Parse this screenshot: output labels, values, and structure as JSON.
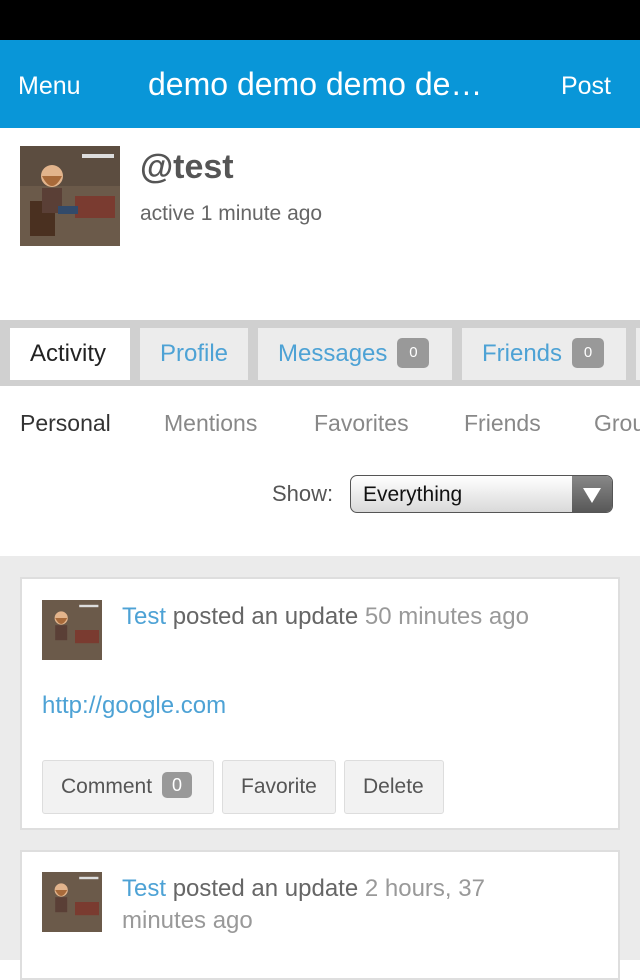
{
  "nav": {
    "menu_label": "Menu",
    "title": "demo demo demo demo",
    "post_label": "Post",
    "color": "#0996d8"
  },
  "profile": {
    "username": "@test",
    "active_text": "active 1 minute ago",
    "avatar_icon": "user-avatar"
  },
  "tabs": [
    {
      "label": "Activity",
      "count": null
    },
    {
      "label": "Profile",
      "count": null
    },
    {
      "label": "Messages",
      "count": "0"
    },
    {
      "label": "Friends",
      "count": "0"
    }
  ],
  "subnav": [
    "Personal",
    "Mentions",
    "Favorites",
    "Friends",
    "Groups"
  ],
  "filter": {
    "label": "Show:",
    "value": "Everything"
  },
  "activities": [
    {
      "user": "Test",
      "action": "posted an update",
      "time": "50 minutes ago",
      "content_link": "http://google.com",
      "buttons": {
        "comment": "Comment",
        "comment_count": "0",
        "favorite": "Favorite",
        "delete": "Delete"
      }
    },
    {
      "user": "Test",
      "action": "posted an update",
      "time": "2 hours, 37 minutes ago"
    }
  ]
}
